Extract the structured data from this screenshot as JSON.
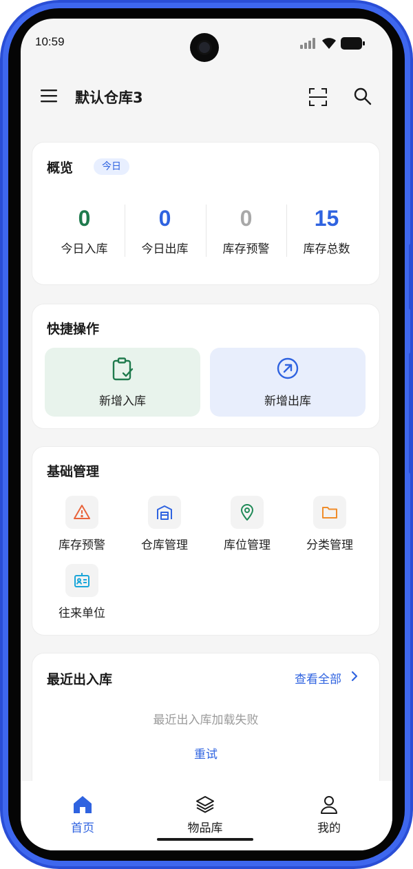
{
  "status_bar": {
    "time": "10:59"
  },
  "header": {
    "title": "默认仓库3"
  },
  "overview": {
    "title": "概览",
    "badge": "今日",
    "stats": [
      {
        "value": "0",
        "label": "今日入库",
        "color": "#1f7a4d"
      },
      {
        "value": "0",
        "label": "今日出库",
        "color": "#2f63e0"
      },
      {
        "value": "0",
        "label": "库存预警",
        "color": "#a8a8a8"
      },
      {
        "value": "15",
        "label": "库存总数",
        "color": "#2f63e0"
      }
    ]
  },
  "quick_actions": {
    "title": "快捷操作",
    "items": [
      {
        "label": "新增入库",
        "icon": "clipboard-check-icon",
        "bg": "#e8f3ec",
        "color": "#1f7a4d"
      },
      {
        "label": "新增出库",
        "icon": "arrow-up-right-circle-icon",
        "bg": "#e8eefc",
        "color": "#2f63e0"
      }
    ]
  },
  "management": {
    "title": "基础管理",
    "items": [
      {
        "label": "库存预警",
        "icon": "warning-triangle-icon",
        "color": "#e8633a"
      },
      {
        "label": "仓库管理",
        "icon": "warehouse-icon",
        "color": "#2f63e0"
      },
      {
        "label": "库位管理",
        "icon": "location-pin-icon",
        "color": "#1f8a57"
      },
      {
        "label": "分类管理",
        "icon": "folder-icon",
        "color": "#f08c2a"
      },
      {
        "label": "往来单位",
        "icon": "id-badge-icon",
        "color": "#1aa6d9"
      }
    ]
  },
  "recent": {
    "title": "最近出入库",
    "view_all": "查看全部",
    "empty_message": "最近出入库加载失败",
    "retry": "重试"
  },
  "tabbar": {
    "items": [
      {
        "label": "首页",
        "icon": "home-icon",
        "active": true
      },
      {
        "label": "物品库",
        "icon": "layers-icon",
        "active": false
      },
      {
        "label": "我的",
        "icon": "user-icon",
        "active": false
      }
    ]
  },
  "colors": {
    "accent": "#2f63e0",
    "frame": "#3e67ee",
    "background": "#f5f5f5"
  }
}
